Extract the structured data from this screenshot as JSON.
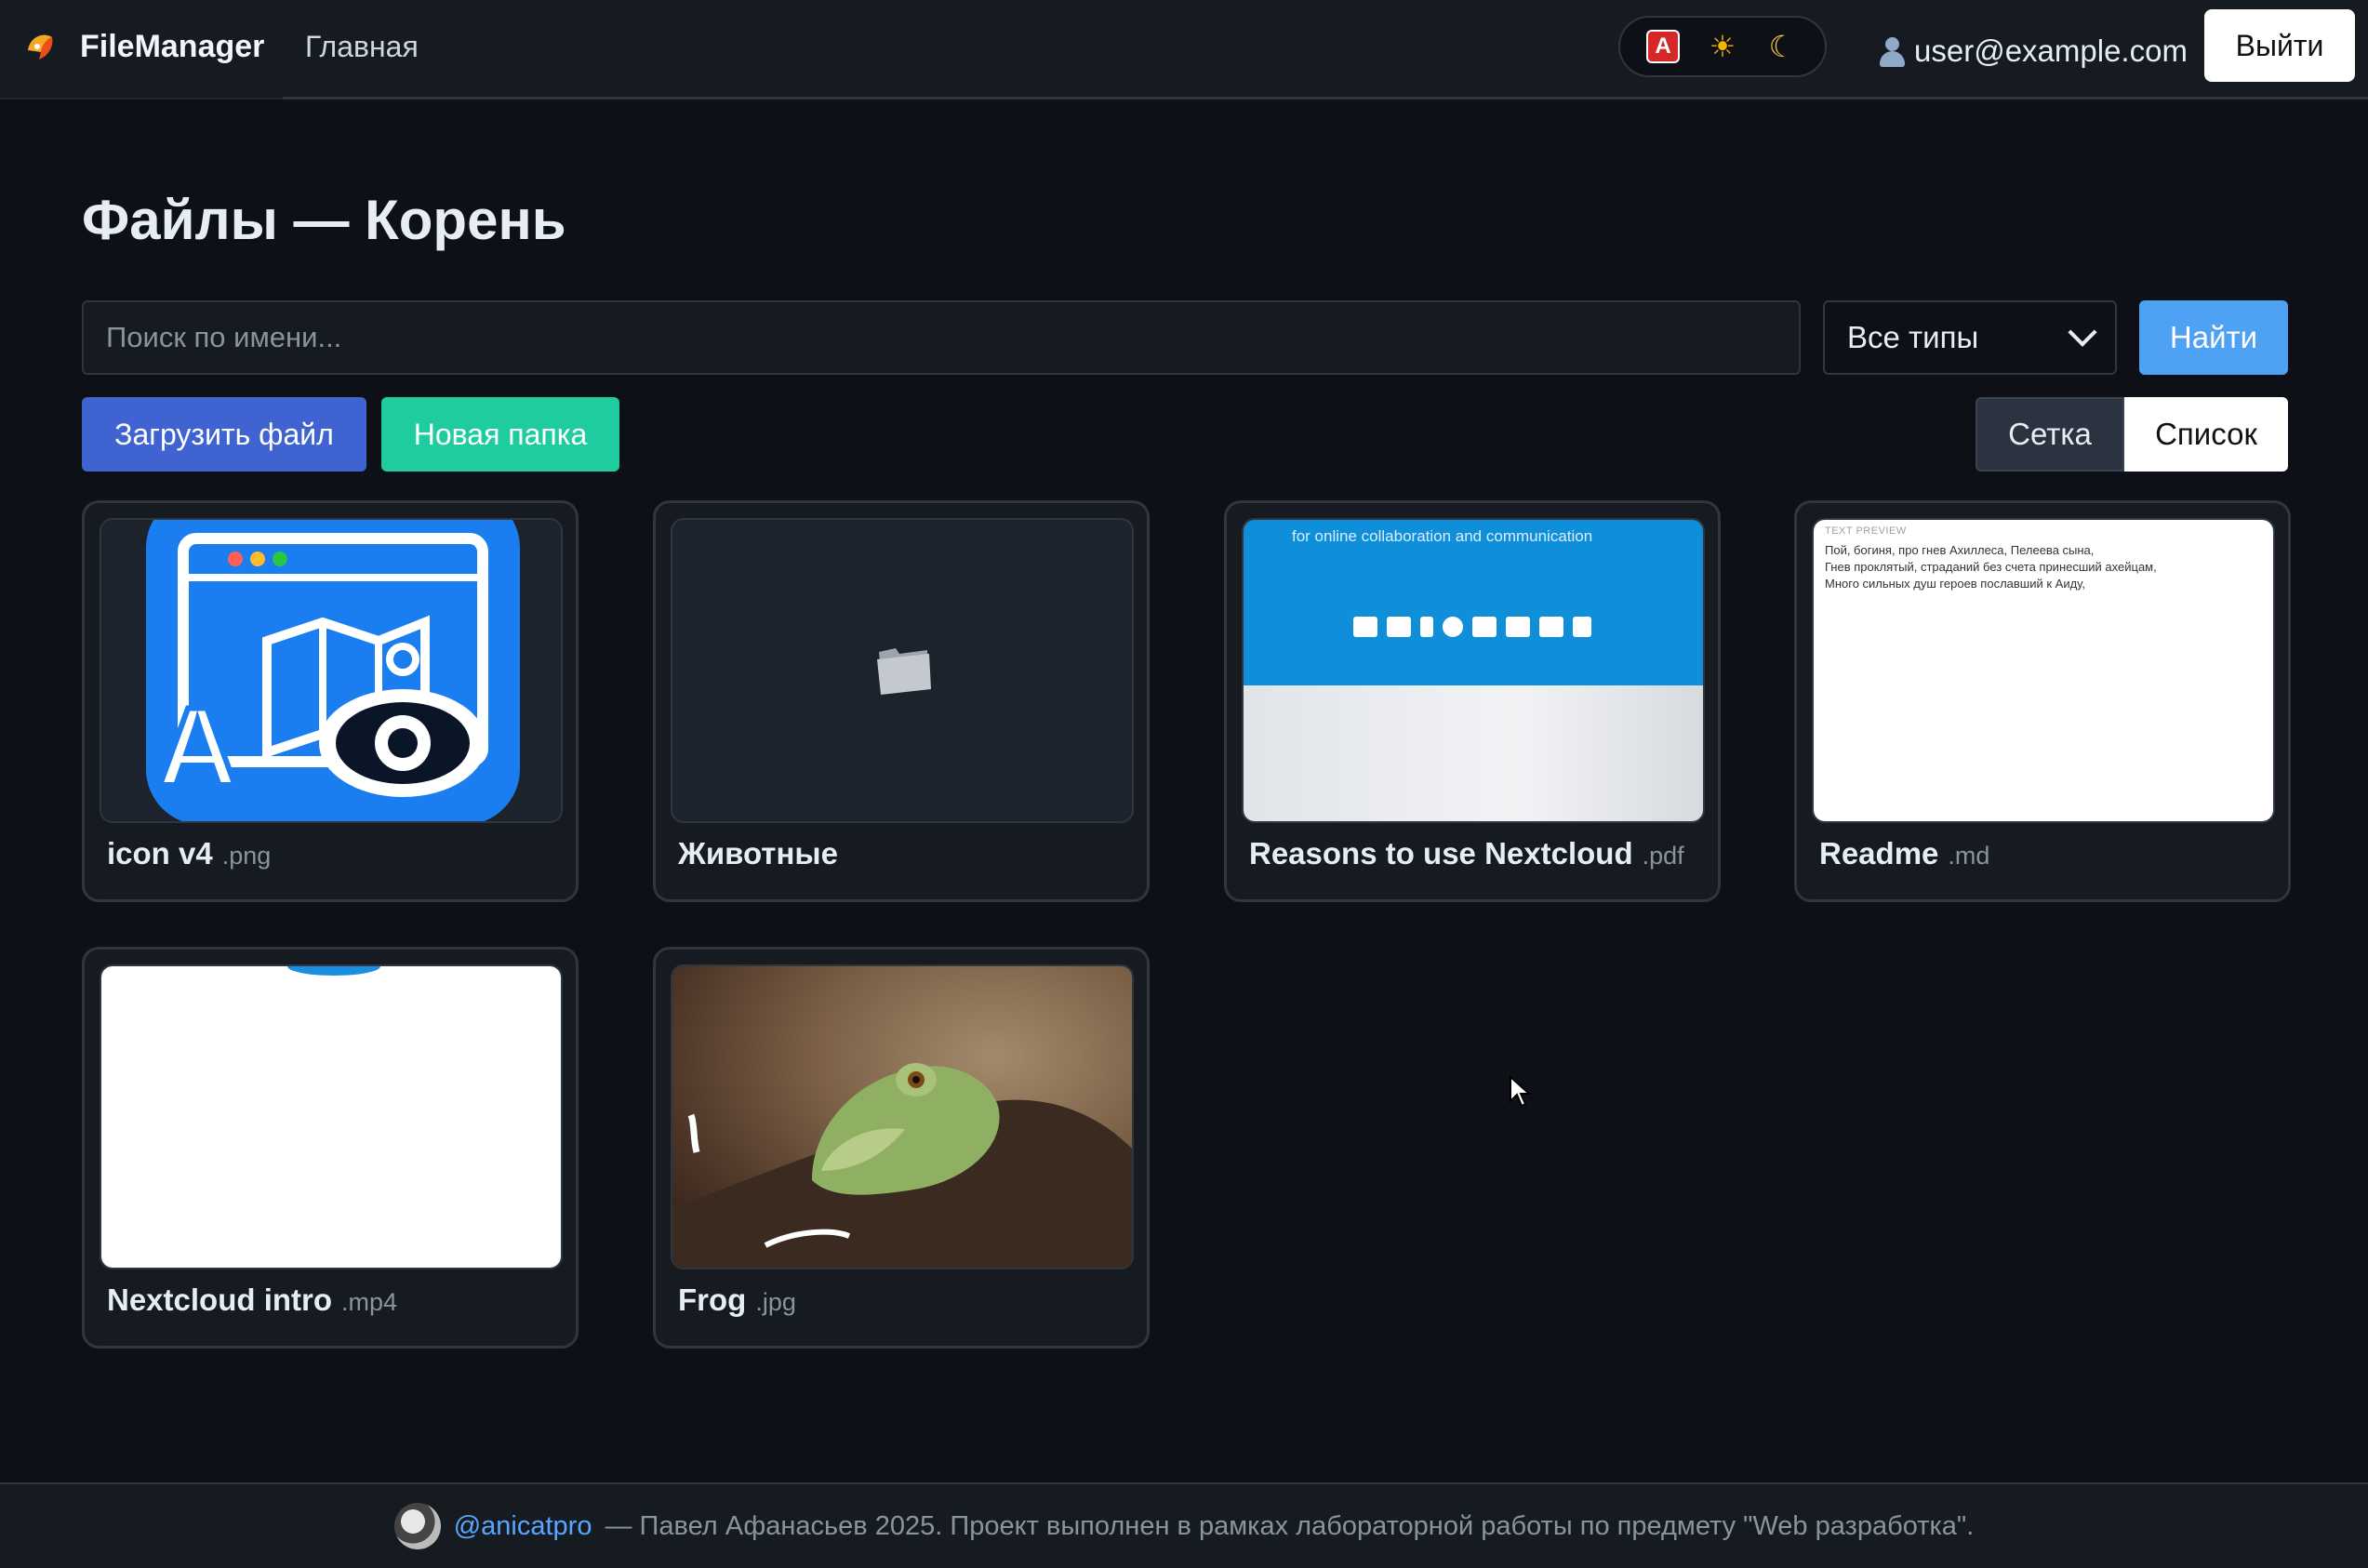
{
  "nav": {
    "brand": "FileManager",
    "home_link": "Главная",
    "theme_auto_label": "A",
    "theme_light_icon": "☀",
    "theme_dark_icon": "☾",
    "user_email": "user@example.com",
    "logout_label": "Выйти"
  },
  "page": {
    "title": "Файлы — Корень"
  },
  "controls": {
    "search_placeholder": "Поиск по имени...",
    "type_selected": "Все типы",
    "find_label": "Найти",
    "upload_label": "Загрузить файл",
    "new_folder_label": "Новая папка",
    "view_grid_label": "Сетка",
    "view_list_label": "Список"
  },
  "files": [
    {
      "name": "icon v4",
      "ext": ".png",
      "kind": "image"
    },
    {
      "name": "Животные",
      "ext": "",
      "kind": "folder"
    },
    {
      "name": "Reasons to use Nextcloud",
      "ext": ".pdf",
      "kind": "pdf"
    },
    {
      "name": "Readme",
      "ext": ".md",
      "kind": "text"
    },
    {
      "name": "Nextcloud intro",
      "ext": ".mp4",
      "kind": "video"
    },
    {
      "name": "Frog",
      "ext": ".jpg",
      "kind": "image"
    }
  ],
  "previews": {
    "nextcloud_tagline": "for online collaboration and communication",
    "readme_label": "TEXT PREVIEW",
    "readme_lines": [
      "Пой, богиня, про гнев Ахиллеса, Пелеева сына,",
      "Гнев проклятый, страданий без счета принесший ахейцам,",
      "Много сильных душ героев пославший к Аиду,"
    ]
  },
  "footer": {
    "handle": "@anicatpro",
    "text": "— Павел Афанасьев 2025. Проект выполнен в рамках лабораторной работы по предмету \"Web разработка\"."
  },
  "colors": {
    "background": "#0d1117",
    "navbar": "#161b22",
    "upload": "#3f63d0",
    "new_folder": "#1ecc9f",
    "find": "#4ea1f3",
    "link": "#58a6ff"
  }
}
